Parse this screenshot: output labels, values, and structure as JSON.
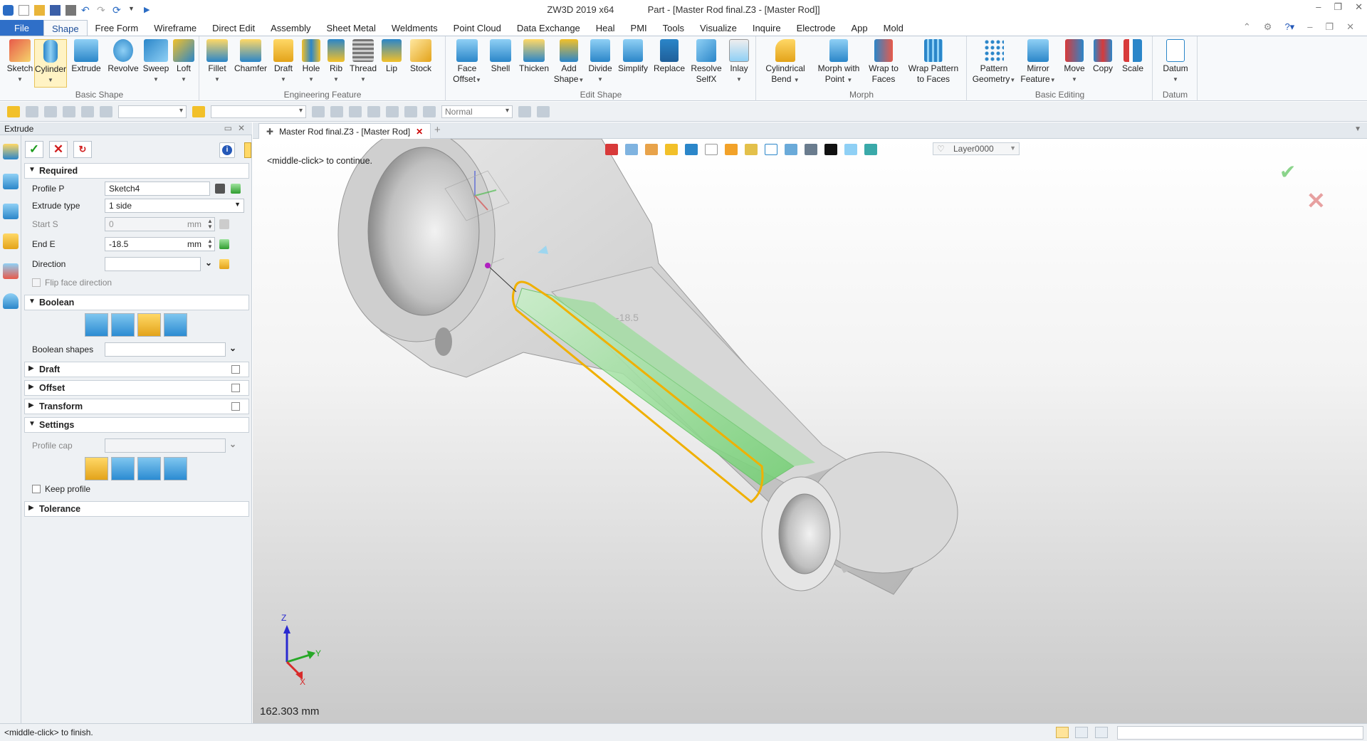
{
  "titlebar": {
    "app_title": "ZW3D 2019  x64",
    "doc_title": "Part - [Master Rod final.Z3 - [Master Rod]]"
  },
  "menu": {
    "file": "File",
    "tabs": [
      "Shape",
      "Free Form",
      "Wireframe",
      "Direct Edit",
      "Assembly",
      "Sheet Metal",
      "Weldments",
      "Point Cloud",
      "Data Exchange",
      "Heal",
      "PMI",
      "Tools",
      "Visualize",
      "Inquire",
      "Electrode",
      "App",
      "Mold"
    ]
  },
  "ribbon": {
    "groups": {
      "basic_shape": "Basic Shape",
      "engineering_feature": "Engineering Feature",
      "edit_shape": "Edit Shape",
      "morph": "Morph",
      "basic_editing": "Basic Editing",
      "datum": "Datum"
    },
    "buttons": {
      "sketch": "Sketch",
      "cylinder": "Cylinder",
      "extrude": "Extrude",
      "revolve": "Revolve",
      "sweep": "Sweep",
      "loft": "Loft",
      "fillet": "Fillet",
      "chamfer": "Chamfer",
      "draft": "Draft",
      "hole": "Hole",
      "rib": "Rib",
      "thread": "Thread",
      "lip": "Lip",
      "stock": "Stock",
      "face_offset_1": "Face",
      "face_offset_2": "Offset",
      "shell": "Shell",
      "thicken": "Thicken",
      "add_shape_1": "Add",
      "add_shape_2": "Shape",
      "divide": "Divide",
      "simplify": "Simplify",
      "replace": "Replace",
      "resolve_1": "Resolve",
      "resolve_2": "SelfX",
      "inlay": "Inlay",
      "cyl_bend_1": "Cylindrical",
      "cyl_bend_2": "Bend",
      "morph_pt_1": "Morph with",
      "morph_pt_2": "Point",
      "wrap_faces_1": "Wrap to",
      "wrap_faces_2": "Faces",
      "wrap_pat_1": "Wrap Pattern",
      "wrap_pat_2": "to Faces",
      "pattern_1": "Pattern",
      "pattern_2": "Geometry",
      "mirror_1": "Mirror",
      "mirror_2": "Feature",
      "move": "Move",
      "copy": "Copy",
      "scale": "Scale",
      "datum": "Datum"
    }
  },
  "toolbar": {
    "render_mode": "Normal"
  },
  "panel": {
    "title": "Extrude",
    "sections": {
      "required": "Required",
      "boolean": "Boolean",
      "draft": "Draft",
      "offset": "Offset",
      "transform": "Transform",
      "settings": "Settings",
      "tolerance": "Tolerance"
    },
    "fields": {
      "profile_label": "Profile P",
      "profile_value": "Sketch4",
      "extrude_type_label": "Extrude type",
      "extrude_type_value": "1 side",
      "start_label": "Start S",
      "start_value": "0",
      "start_unit": "mm",
      "end_label": "End E",
      "end_value": "-18.5",
      "end_unit": "mm",
      "direction_label": "Direction",
      "flip_label": "Flip face direction",
      "boolean_shapes_label": "Boolean shapes",
      "profile_cap_label": "Profile cap",
      "keep_profile_label": "Keep profile"
    }
  },
  "document": {
    "tab_label": "Master Rod final.Z3 - [Master Rod]",
    "layer": "Layer0000",
    "prompt": "<middle-click> to continue.",
    "measurement": "162.303 mm",
    "dimension_label": "-18.5",
    "axes": {
      "x": "X",
      "y": "Y",
      "z": "Z"
    }
  },
  "status": {
    "text": "<middle-click> to finish."
  }
}
